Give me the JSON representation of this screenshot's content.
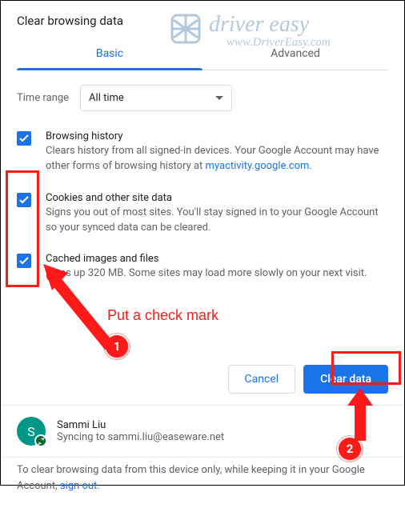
{
  "header": {
    "title": "Clear browsing data"
  },
  "tabs": {
    "basic": "Basic",
    "advanced": "Advanced"
  },
  "timeRange": {
    "label": "Time range",
    "value": "All time"
  },
  "items": [
    {
      "title": "Browsing history",
      "desc_a": "Clears history from all signed-in devices. Your Google Account may have other forms of browsing history at ",
      "link": "myactivity.google.com",
      "desc_b": "."
    },
    {
      "title": "Cookies and other site data",
      "desc": "Signs you out of most sites. You'll stay signed in to your Google Account so your synced data can be cleared."
    },
    {
      "title": "Cached images and files",
      "desc": "Frees up 320 MB. Some sites may load more slowly on your next visit."
    }
  ],
  "actions": {
    "cancel": "Cancel",
    "clear": "Clear data"
  },
  "profile": {
    "name": "Sammi Liu",
    "syncing": "Syncing to sammi.liu@easeware.net",
    "initial": "S"
  },
  "footer": {
    "text_a": "To clear browsing data from this device only, while keeping it in your Google Account, ",
    "link": "sign out",
    "text_b": "."
  },
  "annotations": {
    "text": "Put a check mark",
    "step1": "1",
    "step2": "2"
  },
  "watermark": {
    "line1": "driver easy",
    "line2": "www.DriverEasy.com"
  }
}
